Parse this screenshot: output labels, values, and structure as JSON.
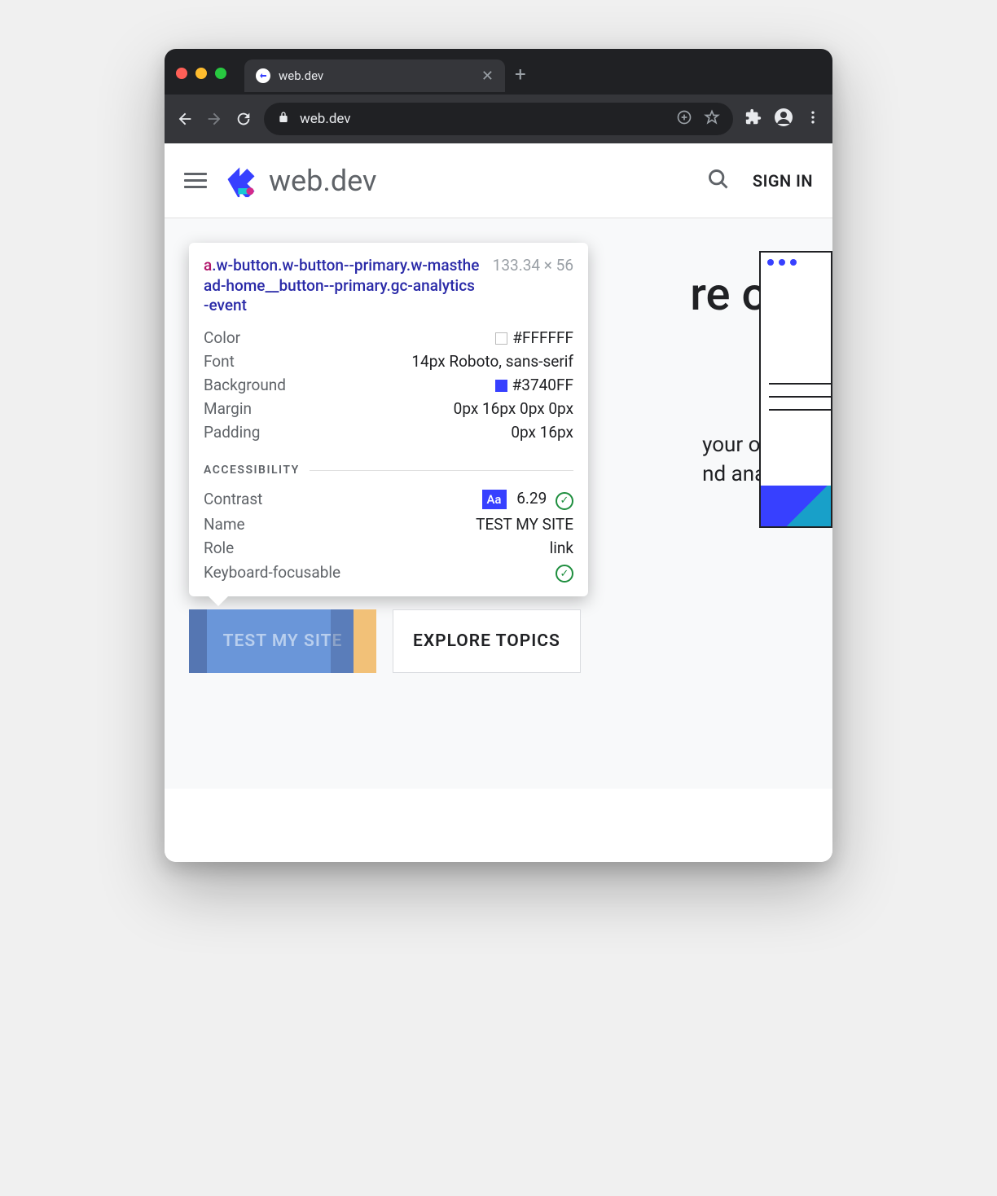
{
  "tab": {
    "title": "web.dev"
  },
  "address": {
    "url": "web.dev"
  },
  "header": {
    "logo_text": "web.dev",
    "signin": "SIGN IN"
  },
  "hero": {
    "heading_fragment": "re of",
    "sub_fragment_1": "your own",
    "sub_fragment_2": "nd analysis"
  },
  "cta": {
    "primary": "TEST MY SITE",
    "secondary": "EXPLORE TOPICS"
  },
  "inspect": {
    "selector_tag": "a",
    "selector_rest": ".w-button.w-button--primary.w-masthead-home__button--primary.gc-analytics-event",
    "dims": "133.34 × 56",
    "rows": {
      "color_label": "Color",
      "color_val": "#FFFFFF",
      "color_swatch": "#FFFFFF",
      "font_label": "Font",
      "font_val": "14px Roboto, sans-serif",
      "bg_label": "Background",
      "bg_val": "#3740FF",
      "bg_swatch": "#3740FF",
      "margin_label": "Margin",
      "margin_val": "0px 16px 0px 0px",
      "padding_label": "Padding",
      "padding_val": "0px 16px"
    },
    "a11y_label": "ACCESSIBILITY",
    "a11y": {
      "contrast_label": "Contrast",
      "contrast_val": "6.29",
      "name_label": "Name",
      "name_val": "TEST MY SITE",
      "role_label": "Role",
      "role_val": "link",
      "kb_label": "Keyboard-focusable"
    }
  }
}
